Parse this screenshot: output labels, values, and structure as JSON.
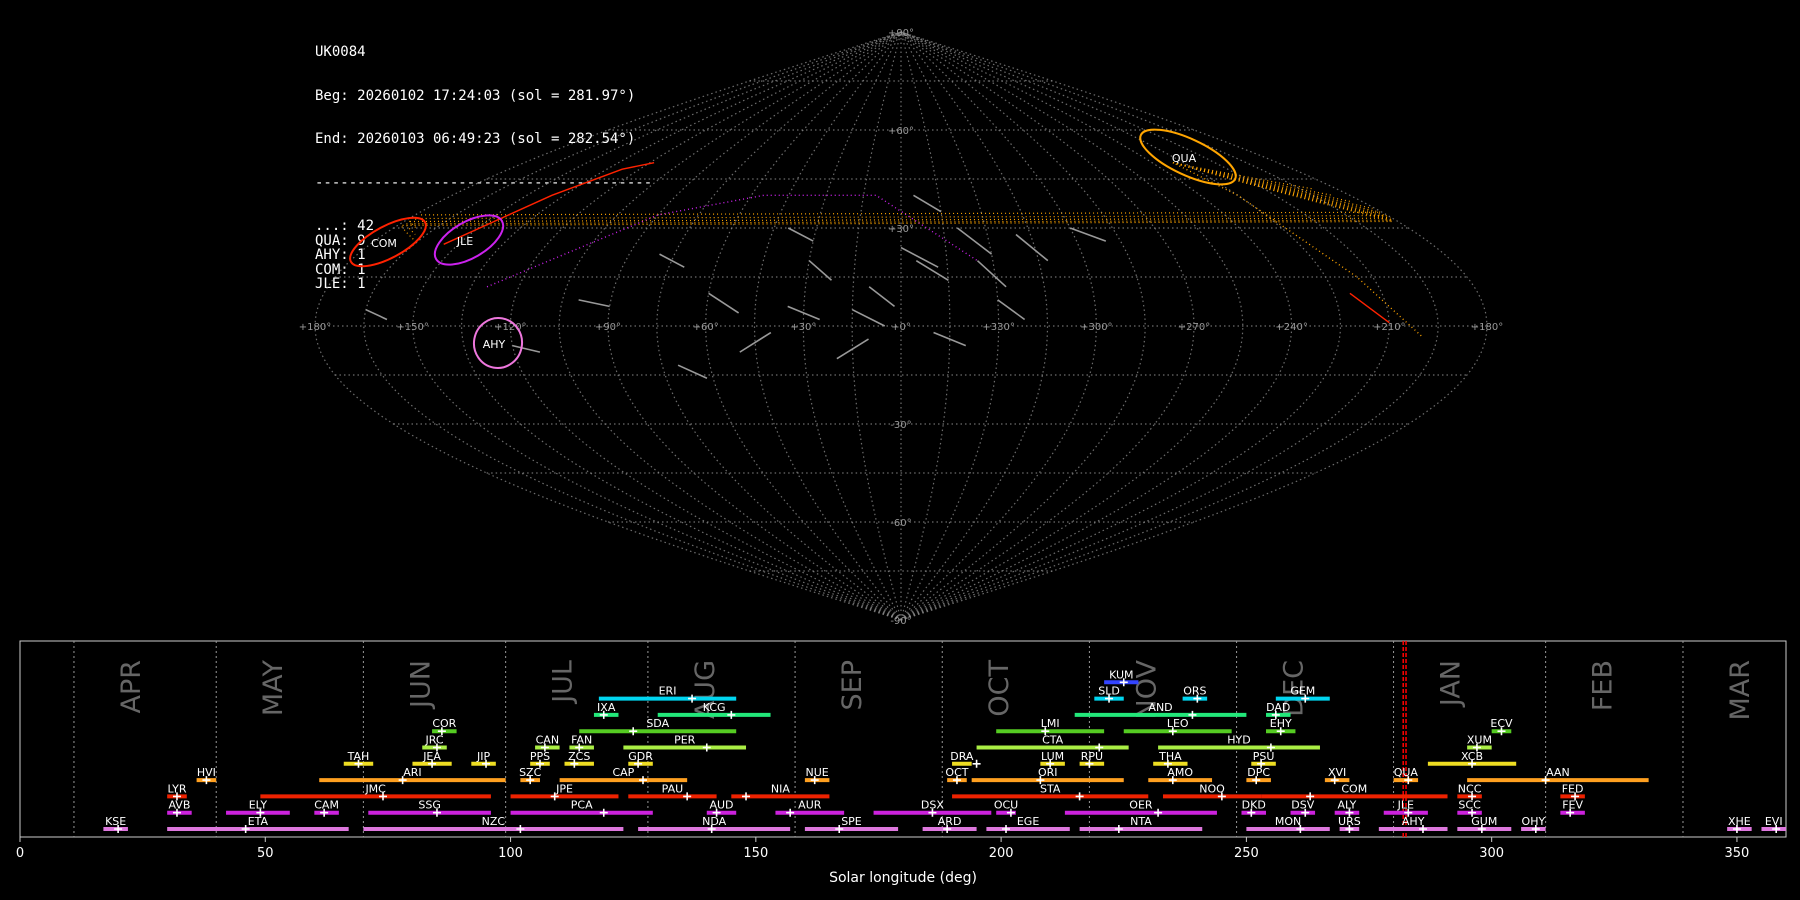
{
  "info": {
    "station": "UK0084",
    "begin": "Beg: 20260102 17:24:03 (sol = 281.97°)",
    "end": "End: 20260103 06:49:23 (sol = 282.54°)",
    "separator": "----------------------------------------",
    "counts": [
      {
        "code": "...",
        "count": 42
      },
      {
        "code": "QUA",
        "count": 9
      },
      {
        "code": "AHY",
        "count": 1
      },
      {
        "code": "COM",
        "count": 1
      },
      {
        "code": "JLE",
        "count": 1
      }
    ]
  },
  "colors": {
    "grid": "#888888",
    "sporadic": "#999999",
    "qua": "#ffa500",
    "com": "#ff2200",
    "jle": "#cc22ee",
    "ahy": "#ee77dd",
    "marker": "#ff0000"
  },
  "sky_map": {
    "projection": "sinusoidal",
    "lon_labels": [
      "+180°",
      "+150°",
      "+120°",
      "+90°",
      "+60°",
      "+30°",
      "+0°",
      "+330°",
      "+300°",
      "+270°",
      "+240°",
      "+210°",
      "+180°"
    ],
    "lat_labels": [
      "+90°",
      "+60°",
      "+30°",
      "-30°",
      "-60°",
      "-90°"
    ],
    "radiants": [
      {
        "code": "COM",
        "lon": 177,
        "lat": 27,
        "color": "#ff2200"
      },
      {
        "code": "JLE",
        "lon": 147,
        "lat": 26,
        "color": "#cc22ee"
      },
      {
        "code": "AHY",
        "lon": 128,
        "lat": -4,
        "color": "#ee77dd"
      },
      {
        "code": "QUA",
        "lon": 230,
        "lat": 50,
        "color": "#ffa500"
      }
    ]
  },
  "chart_data": {
    "type": "timeline",
    "xlabel": "Solar longitude (deg)",
    "xlim": [
      0,
      360
    ],
    "xticks": [
      0,
      50,
      100,
      150,
      200,
      250,
      300,
      350
    ],
    "current_solar_longitude": [
      281.97,
      282.54
    ],
    "months": [
      {
        "name": "APR",
        "sol": 11
      },
      {
        "name": "MAY",
        "sol": 40
      },
      {
        "name": "JUN",
        "sol": 70
      },
      {
        "name": "JUL",
        "sol": 99
      },
      {
        "name": "AUG",
        "sol": 128
      },
      {
        "name": "SEP",
        "sol": 158
      },
      {
        "name": "OCT",
        "sol": 188
      },
      {
        "name": "NOV",
        "sol": 218
      },
      {
        "name": "DEC",
        "sol": 248
      },
      {
        "name": "JAN",
        "sol": 280
      },
      {
        "name": "FEB",
        "sol": 311
      },
      {
        "name": "MAR",
        "sol": 339
      }
    ],
    "showers": [
      {
        "code": "KUM",
        "start": 221,
        "end": 228,
        "peak": 225,
        "row": 9,
        "color": "#3344ff"
      },
      {
        "code": "ERI",
        "start": 118,
        "end": 146,
        "peak": 137,
        "row": 8,
        "color": "#00d5f0"
      },
      {
        "code": "SLD",
        "start": 219,
        "end": 225,
        "peak": 222,
        "row": 8,
        "color": "#00d5f0"
      },
      {
        "code": "ORS",
        "start": 237,
        "end": 242,
        "peak": 240,
        "row": 8,
        "color": "#00d5f0"
      },
      {
        "code": "GEM",
        "start": 256,
        "end": 267,
        "peak": 262,
        "row": 8,
        "color": "#00d5f0"
      },
      {
        "code": "IXA",
        "start": 117,
        "end": 122,
        "peak": 119,
        "row": 7,
        "color": "#22e87a"
      },
      {
        "code": "KCG",
        "start": 130,
        "end": 153,
        "peak": 145,
        "row": 7,
        "color": "#22e87a"
      },
      {
        "code": "AND",
        "start": 215,
        "end": 250,
        "peak": 239,
        "row": 7,
        "color": "#22e87a"
      },
      {
        "code": "DAD",
        "start": 254,
        "end": 259,
        "peak": 256,
        "row": 7,
        "color": "#22e87a"
      },
      {
        "code": "COR",
        "start": 84,
        "end": 89,
        "peak": 86,
        "row": 6,
        "color": "#55cc22"
      },
      {
        "code": "SDA",
        "start": 114,
        "end": 146,
        "peak": 125,
        "row": 6,
        "color": "#55cc22"
      },
      {
        "code": "LMI",
        "start": 199,
        "end": 221,
        "peak": 209,
        "row": 6,
        "color": "#55cc22"
      },
      {
        "code": "LEO",
        "start": 225,
        "end": 247,
        "peak": 235,
        "row": 6,
        "color": "#55cc22"
      },
      {
        "code": "EHY",
        "start": 254,
        "end": 260,
        "peak": 257,
        "row": 6,
        "color": "#55cc22"
      },
      {
        "code": "ECV",
        "start": 300,
        "end": 304,
        "peak": 302,
        "row": 6,
        "color": "#55cc22"
      },
      {
        "code": "JRC",
        "start": 82,
        "end": 87,
        "peak": 85,
        "row": 5,
        "color": "#aaee44"
      },
      {
        "code": "CAN",
        "start": 105,
        "end": 110,
        "peak": 107,
        "row": 5,
        "color": "#aaee44"
      },
      {
        "code": "FAN",
        "start": 112,
        "end": 117,
        "peak": 114,
        "row": 5,
        "color": "#aaee44"
      },
      {
        "code": "PER",
        "start": 123,
        "end": 148,
        "peak": 140,
        "row": 5,
        "color": "#aaee44"
      },
      {
        "code": "CTA",
        "start": 195,
        "end": 226,
        "peak": 220,
        "row": 5,
        "color": "#aaee44"
      },
      {
        "code": "HYD",
        "start": 232,
        "end": 265,
        "peak": 255,
        "row": 5,
        "color": "#aaee44"
      },
      {
        "code": "XUM",
        "start": 295,
        "end": 300,
        "peak": 297,
        "row": 5,
        "color": "#aaee44"
      },
      {
        "code": "TAH",
        "start": 66,
        "end": 72,
        "peak": 69,
        "row": 4,
        "color": "#eedd22"
      },
      {
        "code": "JEA",
        "start": 80,
        "end": 88,
        "peak": 84,
        "row": 4,
        "color": "#eedd22"
      },
      {
        "code": "JIP",
        "start": 92,
        "end": 97,
        "peak": 95,
        "row": 4,
        "color": "#eedd22"
      },
      {
        "code": "PPS",
        "start": 104,
        "end": 108,
        "peak": 106,
        "row": 4,
        "color": "#eedd22"
      },
      {
        "code": "ZCS",
        "start": 111,
        "end": 117,
        "peak": 113,
        "row": 4,
        "color": "#eedd22"
      },
      {
        "code": "GDR",
        "start": 124,
        "end": 129,
        "peak": 126,
        "row": 4,
        "color": "#eedd22"
      },
      {
        "code": "DRA",
        "start": 190,
        "end": 194,
        "peak": 195,
        "row": 4,
        "color": "#eedd22"
      },
      {
        "code": "LUM",
        "start": 208,
        "end": 213,
        "peak": 210,
        "row": 4,
        "color": "#eedd22"
      },
      {
        "code": "RPU",
        "start": 216,
        "end": 221,
        "peak": 218,
        "row": 4,
        "color": "#eedd22"
      },
      {
        "code": "THA",
        "start": 231,
        "end": 238,
        "peak": 234,
        "row": 4,
        "color": "#eedd22"
      },
      {
        "code": "PSU",
        "start": 251,
        "end": 256,
        "peak": 253,
        "row": 4,
        "color": "#eedd22"
      },
      {
        "code": "XCB",
        "start": 287,
        "end": 305,
        "peak": 296,
        "row": 4,
        "color": "#eedd22"
      },
      {
        "code": "HVI",
        "start": 36,
        "end": 40,
        "peak": 38,
        "row": 3,
        "color": "#ffa020"
      },
      {
        "code": "ARI",
        "start": 61,
        "end": 99,
        "peak": 78,
        "row": 3,
        "color": "#ffa020"
      },
      {
        "code": "SZC",
        "start": 102,
        "end": 106,
        "peak": 104,
        "row": 3,
        "color": "#ffa020"
      },
      {
        "code": "CAP",
        "start": 110,
        "end": 136,
        "peak": 127,
        "row": 3,
        "color": "#ffa020"
      },
      {
        "code": "NUE",
        "start": 160,
        "end": 165,
        "peak": 162,
        "row": 3,
        "color": "#ffa020"
      },
      {
        "code": "OCT",
        "start": 189,
        "end": 193,
        "peak": 191,
        "row": 3,
        "color": "#ffa020"
      },
      {
        "code": "ORI",
        "start": 194,
        "end": 225,
        "peak": 208,
        "row": 3,
        "color": "#ffa020"
      },
      {
        "code": "AMO",
        "start": 230,
        "end": 243,
        "peak": 235,
        "row": 3,
        "color": "#ffa020"
      },
      {
        "code": "DPC",
        "start": 250,
        "end": 255,
        "peak": 252,
        "row": 3,
        "color": "#ffa020"
      },
      {
        "code": "XVI",
        "start": 266,
        "end": 271,
        "peak": 268,
        "row": 3,
        "color": "#ffa020"
      },
      {
        "code": "QUA",
        "start": 280,
        "end": 285,
        "peak": 283,
        "row": 3,
        "color": "#ffa020"
      },
      {
        "code": "AAN",
        "start": 295,
        "end": 332,
        "peak": 311,
        "row": 3,
        "color": "#ffa020"
      },
      {
        "code": "LYR",
        "start": 30,
        "end": 34,
        "peak": 32,
        "row": 2,
        "color": "#ee2200"
      },
      {
        "code": "JMC",
        "start": 49,
        "end": 96,
        "peak": 74,
        "row": 2,
        "color": "#ee2200"
      },
      {
        "code": "JPE",
        "start": 100,
        "end": 122,
        "peak": 109,
        "row": 2,
        "color": "#ee2200"
      },
      {
        "code": "PAU",
        "start": 124,
        "end": 142,
        "peak": 136,
        "row": 2,
        "color": "#ee2200"
      },
      {
        "code": "NIA",
        "start": 145,
        "end": 165,
        "peak": 148,
        "row": 2,
        "color": "#ee2200"
      },
      {
        "code": "STA",
        "start": 190,
        "end": 230,
        "peak": 216,
        "row": 2,
        "color": "#ee2200"
      },
      {
        "code": "NOO",
        "start": 233,
        "end": 253,
        "peak": 245,
        "row": 2,
        "color": "#ee2200"
      },
      {
        "code": "COM",
        "start": 253,
        "end": 291,
        "peak": 263,
        "row": 2,
        "color": "#ee2200"
      },
      {
        "code": "NCC",
        "start": 293,
        "end": 298,
        "peak": 296,
        "row": 2,
        "color": "#ee2200"
      },
      {
        "code": "FED",
        "start": 314,
        "end": 319,
        "peak": 317,
        "row": 2,
        "color": "#ee2200"
      },
      {
        "code": "AVB",
        "start": 30,
        "end": 35,
        "peak": 32,
        "row": 1,
        "color": "#cc22dd"
      },
      {
        "code": "ELY",
        "start": 42,
        "end": 55,
        "peak": 49,
        "row": 1,
        "color": "#cc22dd"
      },
      {
        "code": "CAM",
        "start": 60,
        "end": 65,
        "peak": 62,
        "row": 1,
        "color": "#cc22dd"
      },
      {
        "code": "SSG",
        "start": 71,
        "end": 96,
        "peak": 85,
        "row": 1,
        "color": "#cc22dd"
      },
      {
        "code": "PCA",
        "start": 100,
        "end": 129,
        "peak": 119,
        "row": 1,
        "color": "#cc22dd"
      },
      {
        "code": "AUD",
        "start": 140,
        "end": 146,
        "peak": 142,
        "row": 1,
        "color": "#cc22dd"
      },
      {
        "code": "AUR",
        "start": 154,
        "end": 168,
        "peak": 157,
        "row": 1,
        "color": "#cc22dd"
      },
      {
        "code": "DSX",
        "start": 174,
        "end": 198,
        "peak": 186,
        "row": 1,
        "color": "#cc22dd"
      },
      {
        "code": "OCU",
        "start": 199,
        "end": 203,
        "peak": 202,
        "row": 1,
        "color": "#cc22dd"
      },
      {
        "code": "OER",
        "start": 213,
        "end": 244,
        "peak": 232,
        "row": 1,
        "color": "#cc22dd"
      },
      {
        "code": "DKD",
        "start": 249,
        "end": 254,
        "peak": 251,
        "row": 1,
        "color": "#cc22dd"
      },
      {
        "code": "DSV",
        "start": 259,
        "end": 264,
        "peak": 262,
        "row": 1,
        "color": "#cc22dd"
      },
      {
        "code": "ALY",
        "start": 268,
        "end": 273,
        "peak": 271,
        "row": 1,
        "color": "#cc22dd"
      },
      {
        "code": "JLE",
        "start": 278,
        "end": 287,
        "peak": 283,
        "row": 1,
        "color": "#cc22dd"
      },
      {
        "code": "SCC",
        "start": 293,
        "end": 298,
        "peak": 296,
        "row": 1,
        "color": "#cc22dd"
      },
      {
        "code": "FEV",
        "start": 314,
        "end": 319,
        "peak": 316,
        "row": 1,
        "color": "#cc22dd"
      },
      {
        "code": "KSE",
        "start": 17,
        "end": 22,
        "peak": 20,
        "row": 0,
        "color": "#dd77dd"
      },
      {
        "code": "ETA",
        "start": 30,
        "end": 67,
        "peak": 46,
        "row": 0,
        "color": "#dd77dd"
      },
      {
        "code": "NZC",
        "start": 70,
        "end": 123,
        "peak": 102,
        "row": 0,
        "color": "#dd77dd"
      },
      {
        "code": "NDA",
        "start": 126,
        "end": 157,
        "peak": 141,
        "row": 0,
        "color": "#dd77dd"
      },
      {
        "code": "SPE",
        "start": 160,
        "end": 179,
        "peak": 167,
        "row": 0,
        "color": "#dd77dd"
      },
      {
        "code": "ARD",
        "start": 184,
        "end": 195,
        "peak": 189,
        "row": 0,
        "color": "#dd77dd"
      },
      {
        "code": "EGE",
        "start": 197,
        "end": 214,
        "peak": 201,
        "row": 0,
        "color": "#dd77dd"
      },
      {
        "code": "NTA",
        "start": 216,
        "end": 241,
        "peak": 224,
        "row": 0,
        "color": "#dd77dd"
      },
      {
        "code": "MON",
        "start": 250,
        "end": 267,
        "peak": 261,
        "row": 0,
        "color": "#dd77dd"
      },
      {
        "code": "URS",
        "start": 269,
        "end": 273,
        "peak": 271,
        "row": 0,
        "color": "#dd77dd"
      },
      {
        "code": "AHY",
        "start": 277,
        "end": 291,
        "peak": 286,
        "row": 0,
        "color": "#dd77dd"
      },
      {
        "code": "GUM",
        "start": 293,
        "end": 304,
        "peak": 298,
        "row": 0,
        "color": "#dd77dd"
      },
      {
        "code": "OHY",
        "start": 306,
        "end": 311,
        "peak": 309,
        "row": 0,
        "color": "#dd77dd"
      },
      {
        "code": "XHE",
        "start": 348,
        "end": 353,
        "peak": 350,
        "row": 0,
        "color": "#dd77dd"
      },
      {
        "code": "EVI",
        "start": 355,
        "end": 360,
        "peak": 358,
        "row": 0,
        "color": "#dd77dd"
      }
    ]
  }
}
